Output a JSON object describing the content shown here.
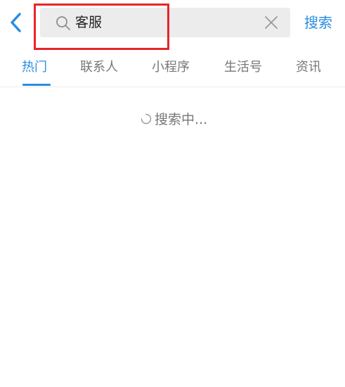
{
  "search": {
    "query": "客服",
    "submit_label": "搜索"
  },
  "tabs": [
    {
      "label": "热门",
      "active": true
    },
    {
      "label": "联系人",
      "active": false
    },
    {
      "label": "小程序",
      "active": false
    },
    {
      "label": "生活号",
      "active": false
    },
    {
      "label": "资讯",
      "active": false
    }
  ],
  "status": {
    "loading_text": "搜索中..."
  },
  "icons": {
    "back": "chevron-left-icon",
    "search": "search-icon",
    "clear": "close-icon",
    "loading": "spinner-icon"
  },
  "colors": {
    "accent": "#2a8ee0",
    "highlight": "#e8242a",
    "search_bg": "#ececec",
    "muted_text": "#777777"
  }
}
